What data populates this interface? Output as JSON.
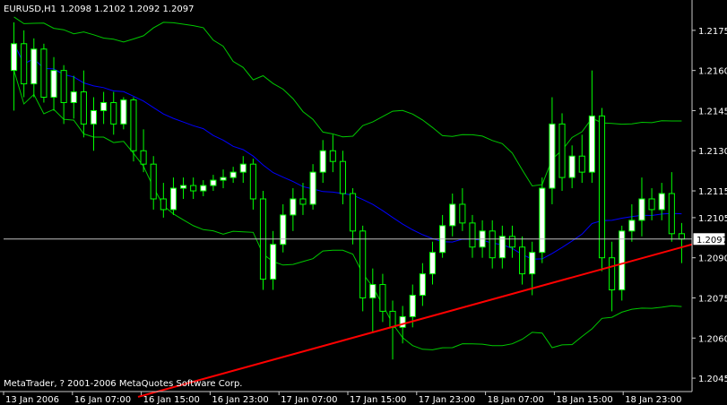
{
  "header": {
    "symbol": "EURUSD,H1",
    "ohlc": "1.2098 1.2102 1.2092 1.2097"
  },
  "copyright": "MetaTrader, ? 2001-2006 MetaQuotes Software Corp.",
  "current_price_label": "1.2097",
  "colors": {
    "background": "#000000",
    "bull_candle": "#ffffff",
    "bear_candle": "#000000",
    "wick": "#00ff00",
    "bands": "#00c800",
    "moving_average": "#0000ff",
    "trendline": "#ff0000",
    "bid_line": "#c0c0c0",
    "axis": "#c8c8c8"
  },
  "chart_data": {
    "type": "candlestick",
    "title": "EURUSD,H1",
    "ylim": [
      1.204,
      1.2185
    ],
    "y_ticks": [
      "1.2175",
      "1.2160",
      "1.2145",
      "1.2130",
      "1.2115",
      "1.2105",
      "1.2090",
      "1.2075",
      "1.2060",
      "1.2045"
    ],
    "x_ticks": [
      "13 Jan 2006",
      "16 Jan 07:00",
      "16 Jan 15:00",
      "16 Jan 23:00",
      "17 Jan 07:00",
      "17 Jan 15:00",
      "17 Jan 23:00",
      "18 Jan 07:00",
      "18 Jan 15:00",
      "18 Jan 23:00"
    ],
    "candles": [
      [
        1.216,
        1.2178,
        1.2145,
        1.217
      ],
      [
        1.217,
        1.2175,
        1.215,
        1.2155
      ],
      [
        1.2155,
        1.2172,
        1.215,
        1.2168
      ],
      [
        1.2168,
        1.217,
        1.2148,
        1.215
      ],
      [
        1.215,
        1.2165,
        1.2145,
        1.216
      ],
      [
        1.216,
        1.2162,
        1.214,
        1.2148
      ],
      [
        1.2148,
        1.2158,
        1.2142,
        1.2152
      ],
      [
        1.2152,
        1.216,
        1.2135,
        1.214
      ],
      [
        1.214,
        1.215,
        1.213,
        1.2145
      ],
      [
        1.2145,
        1.2152,
        1.214,
        1.2148
      ],
      [
        1.2148,
        1.2152,
        1.2136,
        1.214
      ],
      [
        1.214,
        1.215,
        1.2138,
        1.2149
      ],
      [
        1.2149,
        1.215,
        1.2126,
        1.213
      ],
      [
        1.213,
        1.2138,
        1.2122,
        1.2125
      ],
      [
        1.2125,
        1.2128,
        1.2108,
        1.2112
      ],
      [
        1.2112,
        1.2118,
        1.2105,
        1.2108
      ],
      [
        1.2108,
        1.212,
        1.2106,
        1.2116
      ],
      [
        1.2116,
        1.212,
        1.2112,
        1.2117
      ],
      [
        1.2117,
        1.212,
        1.2112,
        1.2115
      ],
      [
        1.2115,
        1.2119,
        1.2113,
        1.2117
      ],
      [
        1.2117,
        1.2121,
        1.2115,
        1.2119
      ],
      [
        1.2119,
        1.2123,
        1.2116,
        1.212
      ],
      [
        1.212,
        1.2124,
        1.2118,
        1.2122
      ],
      [
        1.2122,
        1.2128,
        1.2118,
        1.2125
      ],
      [
        1.2125,
        1.2127,
        1.2108,
        1.2112
      ],
      [
        1.2112,
        1.2115,
        1.2078,
        1.2082
      ],
      [
        1.2082,
        1.21,
        1.2078,
        1.2095
      ],
      [
        1.2095,
        1.211,
        1.2092,
        1.2106
      ],
      [
        1.2106,
        1.2116,
        1.21,
        1.2112
      ],
      [
        1.2112,
        1.2118,
        1.2106,
        1.211
      ],
      [
        1.211,
        1.2125,
        1.2108,
        1.2122
      ],
      [
        1.2122,
        1.2134,
        1.2118,
        1.213
      ],
      [
        1.213,
        1.2136,
        1.2122,
        1.2126
      ],
      [
        1.2126,
        1.213,
        1.211,
        1.2114
      ],
      [
        1.2114,
        1.2116,
        1.2095,
        1.21
      ],
      [
        1.21,
        1.2102,
        1.207,
        1.2075
      ],
      [
        1.2075,
        1.2086,
        1.2062,
        1.208
      ],
      [
        1.208,
        1.2084,
        1.2066,
        1.207
      ],
      [
        1.207,
        1.2074,
        1.2052,
        1.2064
      ],
      [
        1.2064,
        1.2072,
        1.2058,
        1.2068
      ],
      [
        1.2068,
        1.208,
        1.2064,
        1.2076
      ],
      [
        1.2076,
        1.2088,
        1.2072,
        1.2084
      ],
      [
        1.2084,
        1.2096,
        1.208,
        1.2092
      ],
      [
        1.2092,
        1.2106,
        1.209,
        1.2102
      ],
      [
        1.2102,
        1.2114,
        1.2098,
        1.211
      ],
      [
        1.211,
        1.2116,
        1.21,
        1.2103
      ],
      [
        1.2103,
        1.2106,
        1.209,
        1.2094
      ],
      [
        1.2094,
        1.2104,
        1.209,
        1.21
      ],
      [
        1.21,
        1.2104,
        1.2086,
        1.209
      ],
      [
        1.209,
        1.2102,
        1.2086,
        1.2098
      ],
      [
        1.2098,
        1.2102,
        1.209,
        1.2094
      ],
      [
        1.2094,
        1.2098,
        1.208,
        1.2084
      ],
      [
        1.2084,
        1.2096,
        1.2076,
        1.2092
      ],
      [
        1.2092,
        1.212,
        1.2088,
        1.2116
      ],
      [
        1.2116,
        1.215,
        1.211,
        1.214
      ],
      [
        1.214,
        1.2144,
        1.2115,
        1.212
      ],
      [
        1.212,
        1.2132,
        1.2116,
        1.2128
      ],
      [
        1.2128,
        1.2136,
        1.2118,
        1.2122
      ],
      [
        1.2122,
        1.216,
        1.2118,
        1.2143
      ],
      [
        1.2143,
        1.2146,
        1.2085,
        1.209
      ],
      [
        1.209,
        1.2096,
        1.207,
        1.2078
      ],
      [
        1.2078,
        1.2102,
        1.2074,
        1.21
      ],
      [
        1.21,
        1.211,
        1.2096,
        1.2104
      ],
      [
        1.2104,
        1.212,
        1.2098,
        1.2112
      ],
      [
        1.2112,
        1.2116,
        1.2104,
        1.2108
      ],
      [
        1.2108,
        1.2118,
        1.2104,
        1.2114
      ],
      [
        1.2114,
        1.2122,
        1.2096,
        1.2099
      ],
      [
        1.2099,
        1.2103,
        1.2088,
        1.2097
      ]
    ],
    "trendline": [
      [
        1.2038,
        1.2095
      ]
    ]
  }
}
